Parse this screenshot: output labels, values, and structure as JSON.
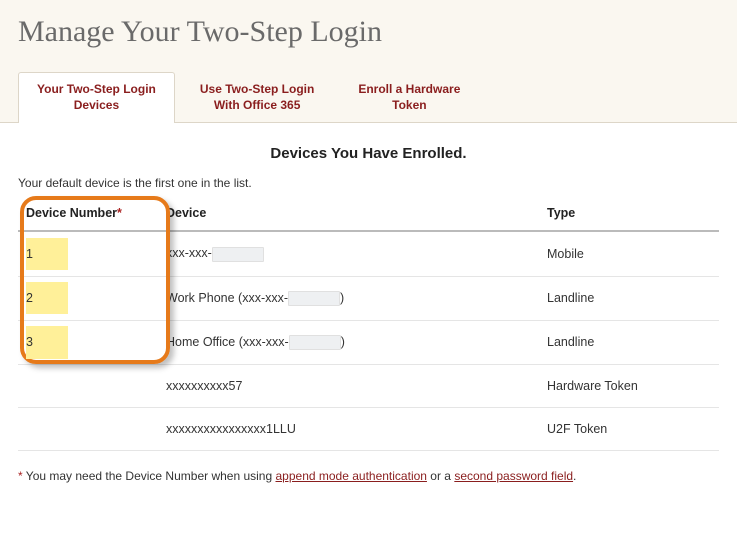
{
  "header": {
    "title": "Manage Your Two-Step Login"
  },
  "tabs": [
    {
      "line1": "Your Two-Step Login",
      "line2": "Devices",
      "active": true
    },
    {
      "line1": "Use Two-Step Login",
      "line2": "With Office 365",
      "active": false
    },
    {
      "line1": "Enroll a Hardware",
      "line2": "Token",
      "active": false
    }
  ],
  "section": {
    "heading": "Devices You Have Enrolled.",
    "intro": "Your default device is the first one in the list."
  },
  "table": {
    "columns": {
      "number": "Device Number",
      "number_req": "*",
      "device": "Device",
      "type": "Type"
    },
    "rows": [
      {
        "num": "1",
        "highlight": true,
        "dev_pre": "xxx-xxx-",
        "dev_mask": true,
        "dev_post": "",
        "type": "Mobile"
      },
      {
        "num": "2",
        "highlight": true,
        "dev_pre": "Work Phone (xxx-xxx-",
        "dev_mask": true,
        "dev_post": ")",
        "type": "Landline"
      },
      {
        "num": "3",
        "highlight": true,
        "dev_pre": "Home Office (xxx-xxx-",
        "dev_mask": true,
        "dev_post": ")",
        "type": "Landline"
      },
      {
        "num": "",
        "highlight": false,
        "dev_pre": "xxxxxxxxxx57",
        "dev_mask": false,
        "dev_post": "",
        "type": "Hardware Token"
      },
      {
        "num": "",
        "highlight": false,
        "dev_pre": "xxxxxxxxxxxxxxxx1LLU",
        "dev_mask": false,
        "dev_post": "",
        "type": "U2F Token"
      }
    ]
  },
  "footnote": {
    "asterisk": "*",
    "text_before": " You may need the Device Number when using ",
    "link1": "append mode authentication",
    "text_mid": " or a ",
    "link2": "second password field",
    "text_after": "."
  }
}
